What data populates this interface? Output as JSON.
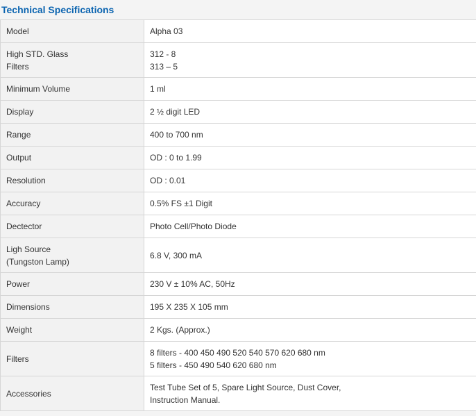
{
  "title": "Technical Specifications",
  "rows": [
    {
      "label": [
        "Model"
      ],
      "value": [
        "Alpha 03"
      ]
    },
    {
      "label": [
        "High STD. Glass",
        "Filters"
      ],
      "value": [
        "312 - 8",
        "313 – 5"
      ]
    },
    {
      "label": [
        "Minimum Volume"
      ],
      "value": [
        "1 ml"
      ]
    },
    {
      "label": [
        "Display"
      ],
      "value": [
        "2 ½ digit LED"
      ]
    },
    {
      "label": [
        "Range"
      ],
      "value": [
        "400 to 700 nm"
      ]
    },
    {
      "label": [
        "Output"
      ],
      "value": [
        "OD : 0 to 1.99"
      ]
    },
    {
      "label": [
        "Resolution"
      ],
      "value": [
        "OD : 0.01"
      ]
    },
    {
      "label": [
        "Accuracy"
      ],
      "value": [
        "0.5% FS ±1 Digit"
      ]
    },
    {
      "label": [
        "Dectector"
      ],
      "value": [
        "Photo Cell/Photo Diode"
      ]
    },
    {
      "label": [
        "Ligh Source",
        "(Tungston Lamp)"
      ],
      "value": [
        "6.8 V, 300 mA"
      ]
    },
    {
      "label": [
        "Power"
      ],
      "value": [
        "230 V ± 10% AC, 50Hz"
      ]
    },
    {
      "label": [
        "Dimensions"
      ],
      "value": [
        "195 X 235 X 105 mm"
      ]
    },
    {
      "label": [
        "Weight"
      ],
      "value": [
        "2 Kgs. (Approx.)"
      ]
    },
    {
      "label": [
        "Filters"
      ],
      "value": [
        "8 filters - 400 450 490 520 540 570 620 680 nm",
        "5 filters - 450 490 540 620 680 nm"
      ]
    },
    {
      "label": [
        "Accessories"
      ],
      "value": [
        "Test Tube Set of 5, Spare Light Source, Dust Cover,",
        "Instruction Manual."
      ]
    }
  ]
}
